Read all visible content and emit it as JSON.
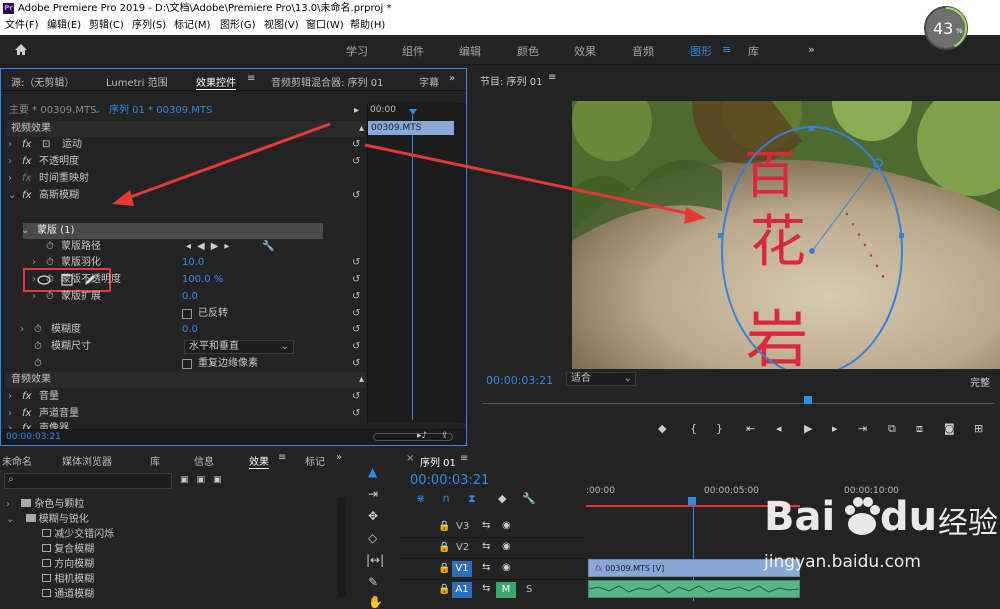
{
  "app": {
    "icon": "Pr",
    "title": "Adobe Premiere Pro 2019 - D:\\文档\\Adobe\\Premiere Pro\\13.0\\未命名.prproj *"
  },
  "menu": [
    "文件(F)",
    "编辑(E)",
    "剪辑(C)",
    "序列(S)",
    "标记(M)",
    "图形(G)",
    "视图(V)",
    "窗口(W)",
    "帮助(H)"
  ],
  "workspaces": [
    "学习",
    "组件",
    "编辑",
    "颜色",
    "效果",
    "音频",
    "图形",
    "库"
  ],
  "active_workspace": "图形",
  "badge": {
    "value": "43",
    "unit": "%"
  },
  "left_tabs": [
    "源:（无剪辑）",
    "Lumetri 范围",
    "效果控件",
    "音频剪辑混合器: 序列 01",
    "字幕"
  ],
  "ec": {
    "master": "主要 * 00309.MTS",
    "seq": "序列 01 * 00309.MTS",
    "tc_ruler": "00:00",
    "clip": "00309.MTS",
    "video_fx": "视频效果",
    "motion": "运动",
    "opacity": "不透明度",
    "time_remap": "时间重映射",
    "gaussian": "高斯模糊",
    "mask": "蒙版 (1)",
    "mask_path": "蒙版路径",
    "mask_feather": "蒙版羽化",
    "mask_feather_v": "10.0",
    "mask_opacity": "蒙版不透明度",
    "mask_opacity_v": "100.0 %",
    "mask_expand": "蒙版扩展",
    "mask_expand_v": "0.0",
    "inverted": "已反转",
    "blurriness": "模糊度",
    "blurriness_v": "0.0",
    "blur_dim": "模糊尺寸",
    "blur_dim_v": "水平和垂直",
    "repeat_edge": "重复边缘像素",
    "audio_fx": "音频效果",
    "volume": "音量",
    "channel_volume": "声道音量",
    "panner": "声像器",
    "bottom_tc": "00:00:03:21",
    "fx_label": "fx"
  },
  "program": {
    "tab": "节目: 序列 01",
    "timecode": "00:00:03:21",
    "fit": "适合",
    "quality": "完整"
  },
  "proj_tabs": [
    "未命名",
    "媒体浏览器",
    "库",
    "信息",
    "效果",
    "标记"
  ],
  "proj_tree": [
    "杂色与颗粒",
    "模糊与锐化",
    "减少交错闪烁",
    "复合模糊",
    "方向模糊",
    "相机模糊",
    "通道模糊"
  ],
  "seq": {
    "tab": "序列 01",
    "timecode": "00:00:03:21",
    "ruler": [
      ":00:00",
      "00:00:05:00",
      "00:00:10:00"
    ],
    "tracks": [
      "V3",
      "V2",
      "V1",
      "A1"
    ],
    "clip_v": "00309.MTS [V]",
    "m": "M",
    "s": "S"
  },
  "watermark": {
    "brand": "Bai",
    "paw": "du",
    "cn": "经验",
    "url": "jingyan.baidu.com"
  }
}
